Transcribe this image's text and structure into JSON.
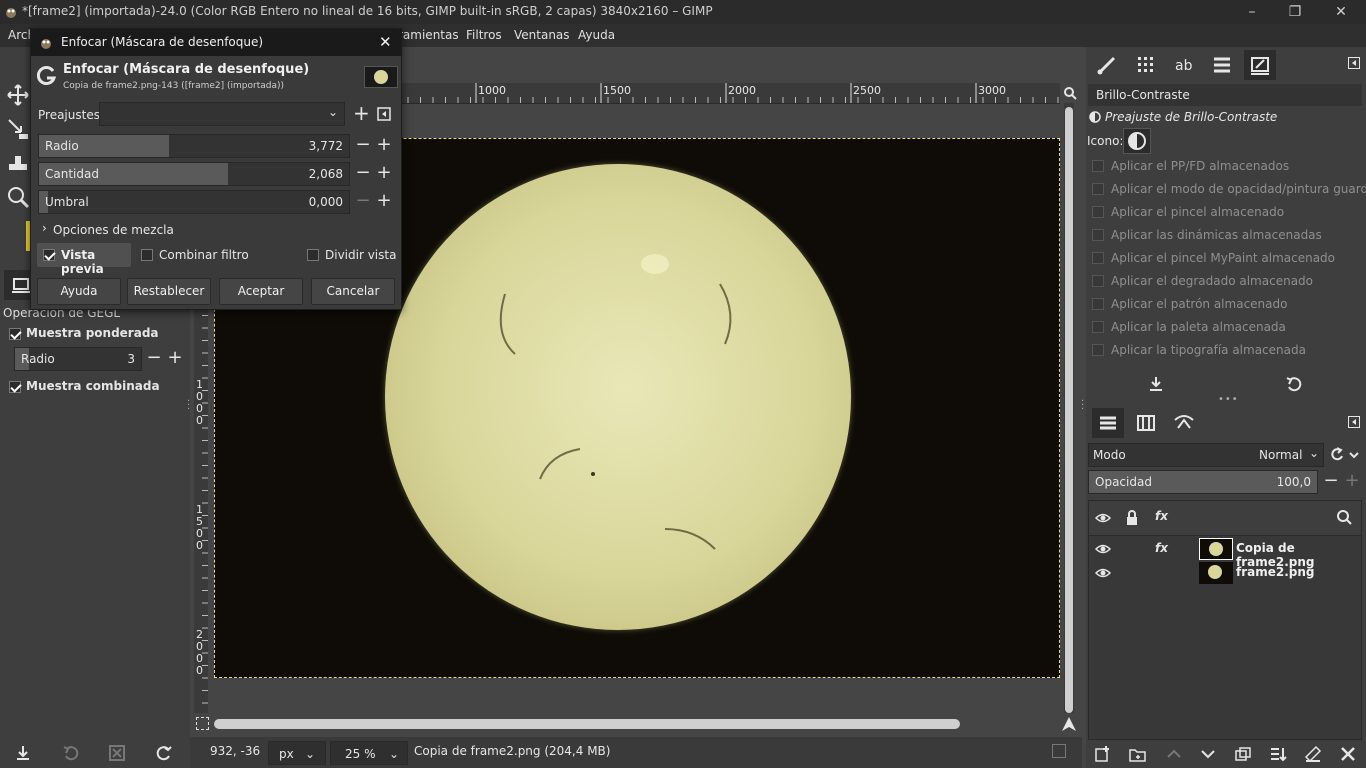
{
  "window": {
    "title": "*[frame2] (importada)-24.0 (Color RGB Entero no lineal de 16 bits, GIMP built-in sRGB, 2 capas) 3840x2160 – GIMP",
    "minimize": "–",
    "maximize": "❐",
    "close": "✕"
  },
  "menubar": {
    "items": [
      "Arch",
      "ramientas",
      "Filtros",
      "Ventanas",
      "Ayuda"
    ]
  },
  "ruler": {
    "top_labels": [
      "1000",
      "1500",
      "2000",
      "2500",
      "3000"
    ],
    "left_labels": [
      "1\n0\n0\n0",
      "1\n5\n0\n0",
      "2\n0\n0\n0"
    ]
  },
  "dialog": {
    "window_title": "Enfocar (Máscara de desenfoque)",
    "header_title": "Enfocar (Máscara de desenfoque)",
    "header_subtitle": "Copia de frame2.png-143 ([frame2] (importada))",
    "presets_label": "Preajustes:",
    "presets_value": "",
    "sliders": [
      {
        "label": "Radio",
        "value": "3,772",
        "fill": 0.42
      },
      {
        "label": "Cantidad",
        "value": "2,068",
        "fill": 0.61
      },
      {
        "label": "Umbral",
        "value": "0,000",
        "fill": 0.03
      }
    ],
    "blend_options": "Opciones de mezcla",
    "preview_label": "Vista previa",
    "preview_checked": true,
    "merge_filter_label": "Combinar filtro",
    "split_view_label": "Dividir vista",
    "buttons": {
      "help": "Ayuda",
      "reset": "Restablecer",
      "ok": "Aceptar",
      "cancel": "Cancelar"
    }
  },
  "gegl": {
    "heading": "Operación de GEGL",
    "weighted_sample": "Muestra ponderada",
    "radius_label": "Radio",
    "radius_value": "3",
    "combined_sample": "Muestra combinada"
  },
  "status": {
    "coords": "932, -36",
    "unit": "px",
    "zoom": "25 %",
    "info": "Copia de frame2.png (204,4 MB)"
  },
  "tool_options": {
    "tool_name": "Brillo-Contraste",
    "preset_title": "Preajuste de Brillo-Contraste",
    "icon_label": "Icono:",
    "options": [
      "Aplicar el PP/FD almacenados",
      "Aplicar el modo de opacidad/pintura guardado",
      "Aplicar el pincel almacenado",
      "Aplicar las dinámicas almacenadas",
      "Aplicar el pincel MyPaint almacenado",
      "Aplicar el degradado almacenado",
      "Aplicar el patrón almacenado",
      "Aplicar la paleta almacenada",
      "Aplicar la tipografía almacenada"
    ]
  },
  "layers": {
    "mode_label": "Modo",
    "mode_value": "Normal",
    "opacity_label": "Opacidad",
    "opacity_value": "100,0",
    "opacity_fill": 1.0,
    "fx": "fx",
    "items": [
      {
        "name": "Copia de frame2.png",
        "has_fx": true
      },
      {
        "name": "frame2.png",
        "has_fx": false
      }
    ]
  },
  "colors": {
    "accent": "#e8e070",
    "sun": "#d9d69a",
    "canvas_bg": "#0f0c07"
  }
}
